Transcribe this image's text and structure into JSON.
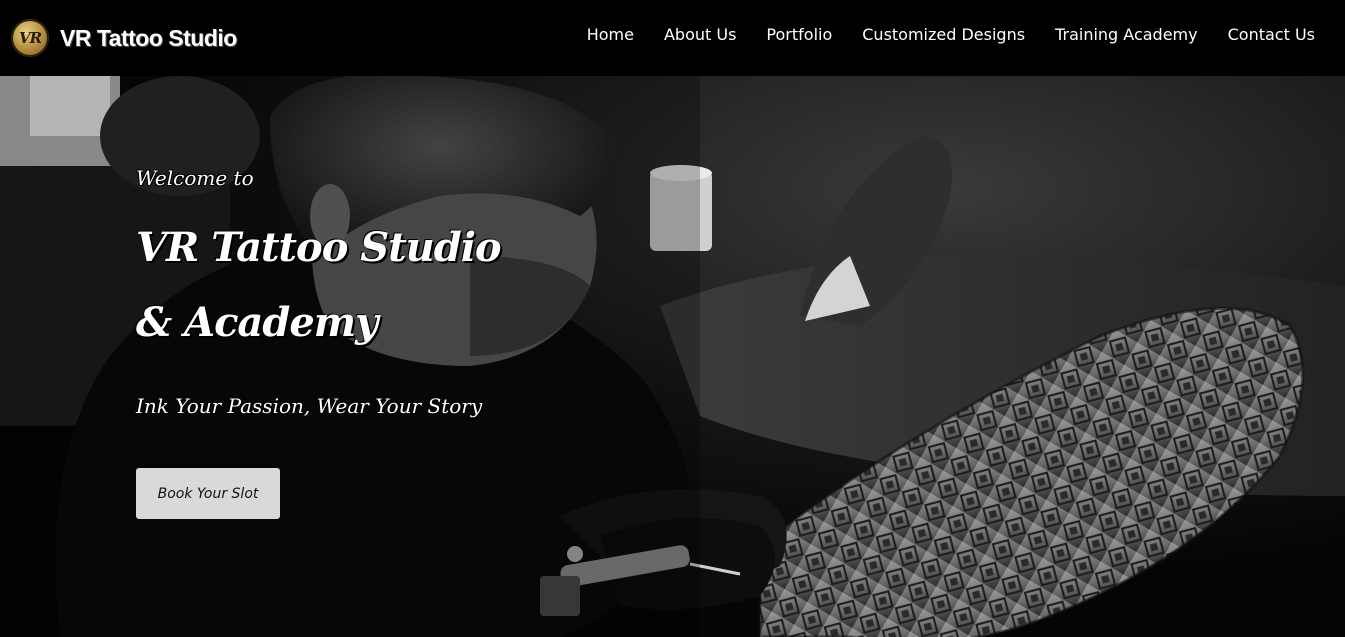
{
  "brand": {
    "logo_text": "VR",
    "name": "VR Tattoo Studio"
  },
  "nav": {
    "items": [
      {
        "label": "Home"
      },
      {
        "label": "About Us"
      },
      {
        "label": "Portfolio"
      },
      {
        "label": "Customized Designs"
      },
      {
        "label": "Training Academy"
      },
      {
        "label": "Contact Us"
      }
    ]
  },
  "hero": {
    "welcome": "Welcome to",
    "title_line1": "VR Tattoo Studio",
    "title_line2": "& Academy",
    "tagline": "Ink Your Passion, Wear Your Story",
    "cta_label": "Book Your Slot",
    "image": "black-and-white photo of tattoo artist tattooing a client's arm"
  },
  "colors": {
    "navbar_bg": "#000000",
    "nav_text": "#ffffff",
    "cta_bg": "#d9d9d9",
    "cta_text": "#111111",
    "logo_gold": "#b99446"
  }
}
